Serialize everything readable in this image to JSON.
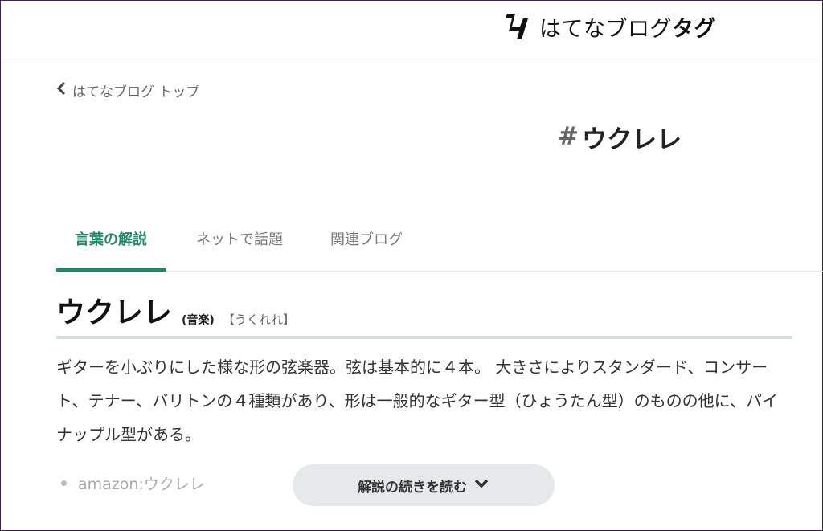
{
  "header": {
    "brand_name": "はてなブログ",
    "brand_suffix": "タグ",
    "logo_icon": "hatena-blog-tag-logo-icon"
  },
  "nav": {
    "back_label": "はてなブログ トップ",
    "back_icon": "chevron-left-icon"
  },
  "tag": {
    "hash": "#",
    "name": "ウクレレ"
  },
  "tabs": [
    {
      "label": "言葉の解説",
      "active": true
    },
    {
      "label": "ネットで話題",
      "active": false
    },
    {
      "label": "関連ブログ",
      "active": false
    }
  ],
  "entry": {
    "word": "ウクレレ",
    "genre": "(音楽)",
    "reading": "【うくれれ】",
    "description": "ギターを小ぶりにした様な形の弦楽器。弦は基本的に４本。 大きさによりスタンダード、コンサート、テナー、バリトンの４種類があり、形は一般的なギター型（ひょうたん型）のものの他に、パイナップル型がある。"
  },
  "links": [
    {
      "label": "amazon:ウクレレ"
    }
  ],
  "read_more": {
    "label": "解説の続きを読む",
    "icon": "chevron-down-icon"
  },
  "colors": {
    "accent": "#1f8a65",
    "frame": "#3d1e52"
  }
}
